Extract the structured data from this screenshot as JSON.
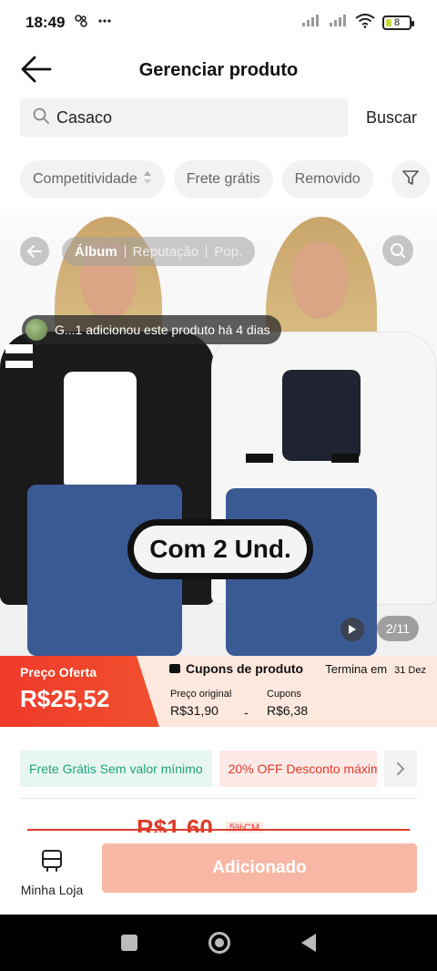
{
  "status_bar": {
    "time": "18:49",
    "battery": "8",
    "left_icons": [
      "link-icon",
      "more-icon"
    ],
    "right_icons": [
      "signal-icon",
      "signal-icon",
      "wifi-icon",
      "battery-icon"
    ]
  },
  "header": {
    "title": "Gerenciar produto"
  },
  "search": {
    "value": "Casaco",
    "button_label": "Buscar"
  },
  "filters": {
    "items": [
      "Competitividade",
      "Frete grátis",
      "Removido"
    ]
  },
  "gallery": {
    "tabs": [
      "Álbum",
      "Reputação",
      "Pop."
    ],
    "active_tab": "Álbum",
    "notice": "G...1 adicionou este produto há 4 dias",
    "overlay_text": "Com 2 Und.",
    "counter": "2/11",
    "colors": {
      "cardigan_black": "#1a1a1a",
      "cardigan_white": "#f6f6f4",
      "jeans": "#3a5a94"
    }
  },
  "price": {
    "offer_label": "Preço Oferta",
    "offer_value": "R$25,52",
    "coupon_title": "Cupons de produto",
    "ends_label": "Termina em",
    "ends_date": "31 Dez",
    "original_label": "Preço original",
    "original_value": "R$31,90",
    "minus": "-",
    "coupons_label": "Cupons",
    "coupons_value": "R$6,38"
  },
  "promos": {
    "free_shipping": "Frete Grátis Sem valor mínimo",
    "discount": "20% OFF Desconto máxim"
  },
  "partial": {
    "price": "R$1,60",
    "tag": "5%CM"
  },
  "bottom": {
    "my_store_label": "Minha Loja",
    "added_label": "Adicionado"
  },
  "accent": "#ef3a2a"
}
